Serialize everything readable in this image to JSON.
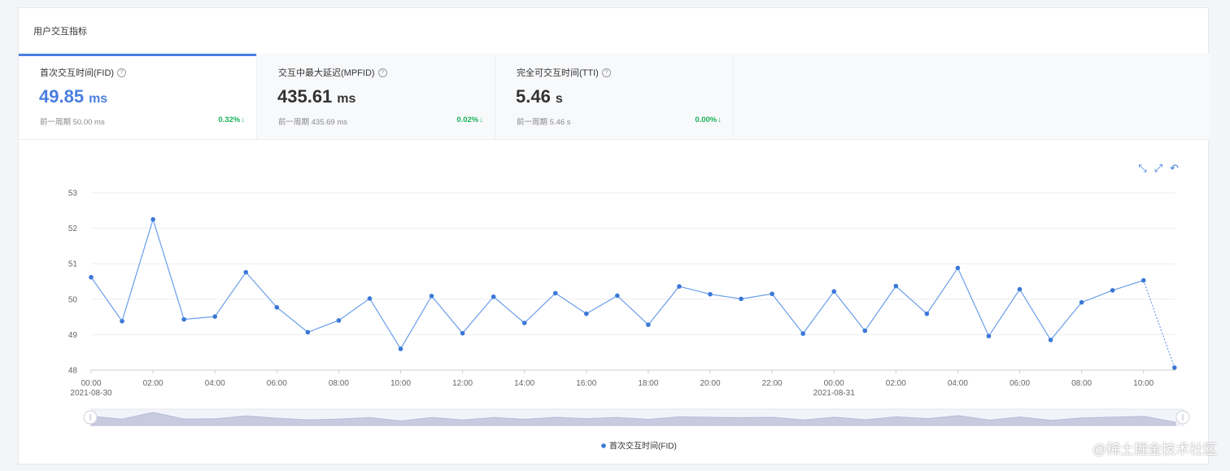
{
  "panel": {
    "title": "用户交互指标"
  },
  "metrics": [
    {
      "label": "首次交互时间(FID)",
      "value": "49.85",
      "unit": "ms",
      "prev": "前一周期 50.00 ms",
      "change": "0.32%"
    },
    {
      "label": "交互中最大延迟(MPFID)",
      "value": "435.61",
      "unit": "ms",
      "prev": "前一周期 435.69 ms",
      "change": "0.02%"
    },
    {
      "label": "完全可交互时间(TTI)",
      "value": "5.46",
      "unit": "s",
      "prev": "前一周期 5.46 s",
      "change": "0.00%"
    }
  ],
  "icons": {
    "help": "?",
    "down_arrow": "↓",
    "zoom": "⤡",
    "zoom_back": "⤢",
    "restore": "↶"
  },
  "colors": {
    "accent": "#4a7fe0",
    "line": "#3a78d7",
    "positive": "#19b25b"
  },
  "watermark": "@稀土掘金技术社区",
  "chart_data": {
    "type": "line",
    "title": "",
    "ylim": [
      48,
      53
    ],
    "y_ticks": [
      "53",
      "52",
      "51",
      "50",
      "49",
      "48"
    ],
    "x_tick_labels": [
      "00:00",
      "02:00",
      "04:00",
      "06:00",
      "08:00",
      "10:00",
      "12:00",
      "14:00",
      "16:00",
      "18:00",
      "20:00",
      "22:00",
      "00:00",
      "02:00",
      "04:00",
      "06:00",
      "08:00",
      "10:00"
    ],
    "x_date_labels": [
      "2021-08-30",
      "2021-08-31"
    ],
    "legend": "bottom-center",
    "grid": true,
    "series": [
      {
        "name": "首次交互时间(FID)",
        "values": [
          50.62,
          49.38,
          52.25,
          49.43,
          49.51,
          50.76,
          49.77,
          49.07,
          49.4,
          50.02,
          48.6,
          50.09,
          49.04,
          50.07,
          49.33,
          50.17,
          49.59,
          50.1,
          49.28,
          50.36,
          50.14,
          50.01,
          50.15,
          49.03,
          50.22,
          49.11,
          50.37,
          49.59,
          50.88,
          48.96,
          50.28,
          48.85,
          49.91,
          50.25,
          50.53,
          48.07
        ]
      }
    ]
  }
}
